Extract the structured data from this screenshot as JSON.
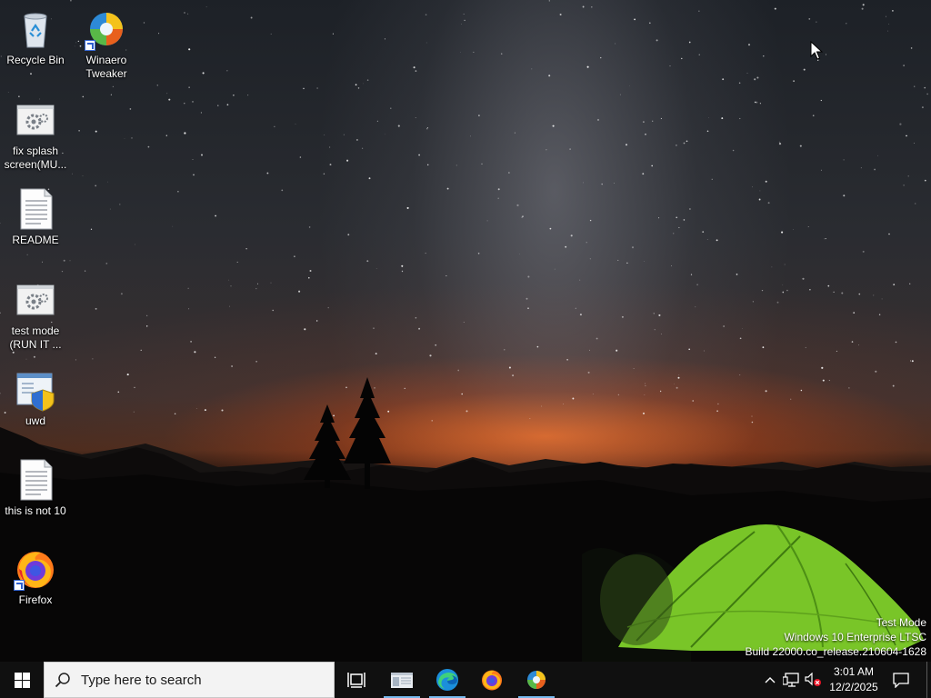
{
  "desktop": {
    "icons": [
      {
        "label": "Recycle Bin",
        "icon": "recycle-bin-icon"
      },
      {
        "label": "Winaero Tweaker",
        "icon": "winaero-tweaker-icon"
      },
      {
        "label": "fix splash screen(MU...",
        "icon": "settings-file-icon"
      },
      {
        "label": "README",
        "icon": "text-document-icon"
      },
      {
        "label": "test mode (RUN IT ...",
        "icon": "settings-file-icon"
      },
      {
        "label": "uwd",
        "icon": "uwd-app-icon"
      },
      {
        "label": "this is not 10",
        "icon": "text-document-icon"
      },
      {
        "label": "Firefox",
        "icon": "firefox-icon"
      }
    ]
  },
  "watermark": {
    "line1": "Test Mode",
    "line2": "Windows 10 Enterprise LTSC",
    "line3": "Build 22000.co_release.210604-1628"
  },
  "taskbar": {
    "search_placeholder": "Type here to search",
    "clock_time": "3:01 AM",
    "clock_date": "12/2/2025",
    "pinned": [
      "task-view-icon",
      "file-explorer-icon",
      "edge-icon",
      "firefox-icon",
      "winaero-tweaker-icon"
    ]
  },
  "colors": {
    "taskbar": "#101010",
    "active_indicator": "#76b9ed",
    "search_box": "#f3f3f3",
    "tent_green": "#7fd02a",
    "horizon_orange": "#ff6e1e"
  }
}
